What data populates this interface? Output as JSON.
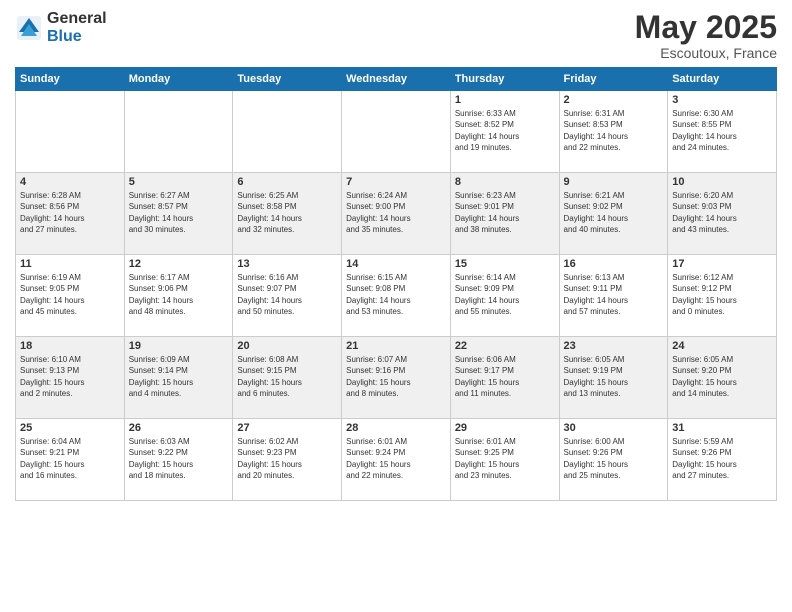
{
  "logo": {
    "general": "General",
    "blue": "Blue"
  },
  "title": {
    "month": "May 2025",
    "location": "Escoutoux, France"
  },
  "weekdays": [
    "Sunday",
    "Monday",
    "Tuesday",
    "Wednesday",
    "Thursday",
    "Friday",
    "Saturday"
  ],
  "weeks": [
    [
      {
        "day": "",
        "info": ""
      },
      {
        "day": "",
        "info": ""
      },
      {
        "day": "",
        "info": ""
      },
      {
        "day": "",
        "info": ""
      },
      {
        "day": "1",
        "info": "Sunrise: 6:33 AM\nSunset: 8:52 PM\nDaylight: 14 hours\nand 19 minutes."
      },
      {
        "day": "2",
        "info": "Sunrise: 6:31 AM\nSunset: 8:53 PM\nDaylight: 14 hours\nand 22 minutes."
      },
      {
        "day": "3",
        "info": "Sunrise: 6:30 AM\nSunset: 8:55 PM\nDaylight: 14 hours\nand 24 minutes."
      }
    ],
    [
      {
        "day": "4",
        "info": "Sunrise: 6:28 AM\nSunset: 8:56 PM\nDaylight: 14 hours\nand 27 minutes."
      },
      {
        "day": "5",
        "info": "Sunrise: 6:27 AM\nSunset: 8:57 PM\nDaylight: 14 hours\nand 30 minutes."
      },
      {
        "day": "6",
        "info": "Sunrise: 6:25 AM\nSunset: 8:58 PM\nDaylight: 14 hours\nand 32 minutes."
      },
      {
        "day": "7",
        "info": "Sunrise: 6:24 AM\nSunset: 9:00 PM\nDaylight: 14 hours\nand 35 minutes."
      },
      {
        "day": "8",
        "info": "Sunrise: 6:23 AM\nSunset: 9:01 PM\nDaylight: 14 hours\nand 38 minutes."
      },
      {
        "day": "9",
        "info": "Sunrise: 6:21 AM\nSunset: 9:02 PM\nDaylight: 14 hours\nand 40 minutes."
      },
      {
        "day": "10",
        "info": "Sunrise: 6:20 AM\nSunset: 9:03 PM\nDaylight: 14 hours\nand 43 minutes."
      }
    ],
    [
      {
        "day": "11",
        "info": "Sunrise: 6:19 AM\nSunset: 9:05 PM\nDaylight: 14 hours\nand 45 minutes."
      },
      {
        "day": "12",
        "info": "Sunrise: 6:17 AM\nSunset: 9:06 PM\nDaylight: 14 hours\nand 48 minutes."
      },
      {
        "day": "13",
        "info": "Sunrise: 6:16 AM\nSunset: 9:07 PM\nDaylight: 14 hours\nand 50 minutes."
      },
      {
        "day": "14",
        "info": "Sunrise: 6:15 AM\nSunset: 9:08 PM\nDaylight: 14 hours\nand 53 minutes."
      },
      {
        "day": "15",
        "info": "Sunrise: 6:14 AM\nSunset: 9:09 PM\nDaylight: 14 hours\nand 55 minutes."
      },
      {
        "day": "16",
        "info": "Sunrise: 6:13 AM\nSunset: 9:11 PM\nDaylight: 14 hours\nand 57 minutes."
      },
      {
        "day": "17",
        "info": "Sunrise: 6:12 AM\nSunset: 9:12 PM\nDaylight: 15 hours\nand 0 minutes."
      }
    ],
    [
      {
        "day": "18",
        "info": "Sunrise: 6:10 AM\nSunset: 9:13 PM\nDaylight: 15 hours\nand 2 minutes."
      },
      {
        "day": "19",
        "info": "Sunrise: 6:09 AM\nSunset: 9:14 PM\nDaylight: 15 hours\nand 4 minutes."
      },
      {
        "day": "20",
        "info": "Sunrise: 6:08 AM\nSunset: 9:15 PM\nDaylight: 15 hours\nand 6 minutes."
      },
      {
        "day": "21",
        "info": "Sunrise: 6:07 AM\nSunset: 9:16 PM\nDaylight: 15 hours\nand 8 minutes."
      },
      {
        "day": "22",
        "info": "Sunrise: 6:06 AM\nSunset: 9:17 PM\nDaylight: 15 hours\nand 11 minutes."
      },
      {
        "day": "23",
        "info": "Sunrise: 6:05 AM\nSunset: 9:19 PM\nDaylight: 15 hours\nand 13 minutes."
      },
      {
        "day": "24",
        "info": "Sunrise: 6:05 AM\nSunset: 9:20 PM\nDaylight: 15 hours\nand 14 minutes."
      }
    ],
    [
      {
        "day": "25",
        "info": "Sunrise: 6:04 AM\nSunset: 9:21 PM\nDaylight: 15 hours\nand 16 minutes."
      },
      {
        "day": "26",
        "info": "Sunrise: 6:03 AM\nSunset: 9:22 PM\nDaylight: 15 hours\nand 18 minutes."
      },
      {
        "day": "27",
        "info": "Sunrise: 6:02 AM\nSunset: 9:23 PM\nDaylight: 15 hours\nand 20 minutes."
      },
      {
        "day": "28",
        "info": "Sunrise: 6:01 AM\nSunset: 9:24 PM\nDaylight: 15 hours\nand 22 minutes."
      },
      {
        "day": "29",
        "info": "Sunrise: 6:01 AM\nSunset: 9:25 PM\nDaylight: 15 hours\nand 23 minutes."
      },
      {
        "day": "30",
        "info": "Sunrise: 6:00 AM\nSunset: 9:26 PM\nDaylight: 15 hours\nand 25 minutes."
      },
      {
        "day": "31",
        "info": "Sunrise: 5:59 AM\nSunset: 9:26 PM\nDaylight: 15 hours\nand 27 minutes."
      }
    ]
  ]
}
